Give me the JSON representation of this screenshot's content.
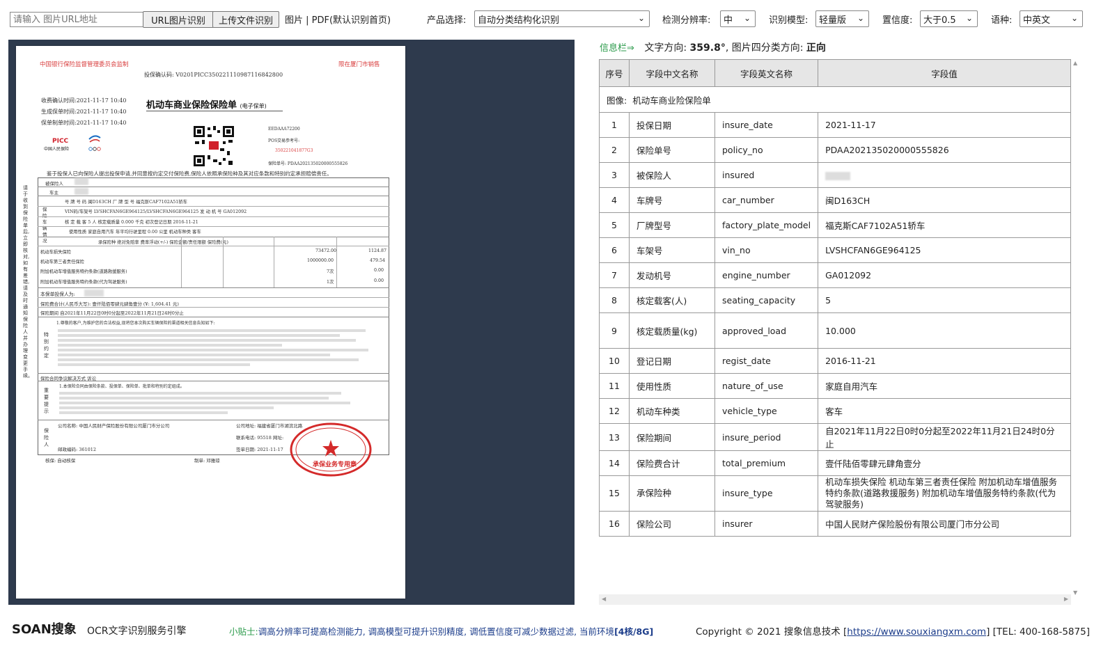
{
  "toolbar": {
    "url_placeholder": "请输入 图片URL地址",
    "url_button": "URL图片识别",
    "upload_button": "上传文件识别",
    "file_hint": "图片 | PDF(默认识别首页)",
    "product_label": "产品选择:",
    "product_value": "自动分类结构化识别",
    "resolution_label": "检测分辨率:",
    "resolution_value": "中",
    "model_label": "识别模型:",
    "model_value": "轻量版",
    "confidence_label": "置信度:",
    "confidence_value": "大于0.5",
    "language_label": "语种:",
    "language_value": "中英文"
  },
  "document": {
    "header_left": "中国银行保险监督管理委员会监制",
    "header_right": "限在厦门市销售",
    "confirm_code": "投保确认码: V0201PICC350221110987116842800",
    "receipt_time": "收费确认时间:2021-11-17 10:40",
    "gen_time": "生成保单时间:2021-11-17 10:40",
    "print_time": "保单制单时间:2021-11-17 10:40",
    "title": "机动车商业保险保险单",
    "title_suffix": "(电子保单)",
    "logo": "PICC",
    "logo_sub": "中国人民保险",
    "ref1": "EEDAAA72200",
    "ref2": "POS交易参考号:",
    "ref3": "350221041877G3",
    "policy_no_line": "保险单号: PDAA202135020000555826",
    "intro": "鉴于投保人已向保险人提出投保申请,并同意按约定交付保险费,保险人依照承保险种及其对应条款和特别约定承担赔偿责任。",
    "plate_row": "号 牌 号 码   闽D163CH      厂 牌 型 号   福克斯CAF7102A51轿车",
    "vin_row": "VIN码/车架号  LVSHCFAN6GE964125/LVSHCFAN6GE964125    发 动 机 号  GA012092",
    "cap_row": "核 定 载 客   5   人   核定载质量  0.000   千克   初次登记日期   2016-11-21",
    "use_row": "使用性质  家庭自用汽车   年平均行驶里程  0.00   公里   机动车种类   客车",
    "cov_header": "承保险种        绝对免赔率     费率浮动(+/-)     保险金额/责任限额     保险费(元)",
    "cov1": "机动车损失保险",
    "cov1_amt": "73472.00",
    "cov1_fee": "1124.87",
    "cov2": "机动车第三者责任保险",
    "cov2_amt": "1000000.00",
    "cov2_fee": "479.54",
    "cov3": "附加机动车增值服务特约条款(道路救援服务)",
    "cov3_amt": "7次",
    "cov3_fee": "0.00",
    "cov4": "附加机动车增值服务特约条款(代为驾驶服务)",
    "cov4_amt": "1次",
    "cov4_fee": "0.00",
    "applicant": "本保单投保人为:",
    "total": "保险费合计(人民币大写):       壹仟陆佰零肆元肆角壹分                (¥: 1,604.41         元)",
    "period": "保险期间  自2021年11月22日0时0分起至2022年11月21日24时0分止",
    "special_text": "1.尊敬的客户,为维护您的合法权益,现将您本次购买车辆保险的渠道相关信息告知如下:",
    "dispute": "保险合同争议解决方式   诉讼",
    "important_text": "1.本保险合同由保险条款、投保单、保险单、批单和特别约定组成。",
    "insurer_name": "公司名称: 中国人民财产保险股份有限公司厦门市分公司",
    "insurer_addr": "公司地址: 福建省厦门市湖滨北路",
    "insurer_phone": "联系电话: 95518  网址:",
    "postcode": "邮政编码: 361012",
    "sign_date": "签单日期: 2021-11-17",
    "underwrite": "核保: 自动核保",
    "maker": "制单: 邓雅琼",
    "stamp_text": "承保业务专用章",
    "side_note": "请于收到保险单后,立即核对,如有差错,请及时通知保险人并办理变更手续。"
  },
  "info": {
    "label": "信息栏⇒",
    "text_dir_label": "文字方向:",
    "text_dir_value": "359.8°",
    "img_dir_label": "图片四分类方向:",
    "img_dir_value": "正向"
  },
  "table": {
    "headers": [
      "序号",
      "字段中文名称",
      "字段英文名称",
      "字段值"
    ],
    "image_row_label": "图像:",
    "image_row_value": "机动车商业险保险单",
    "rows": [
      {
        "no": "1",
        "cn": "投保日期",
        "en": "insure_date",
        "val": "2021-11-17"
      },
      {
        "no": "2",
        "cn": "保险单号",
        "en": "policy_no",
        "val": "PDAA202135020000555826"
      },
      {
        "no": "3",
        "cn": "被保险人",
        "en": "insured",
        "val": ""
      },
      {
        "no": "4",
        "cn": "车牌号",
        "en": "car_number",
        "val": "闽D163CH"
      },
      {
        "no": "5",
        "cn": "厂牌型号",
        "en": "factory_plate_model",
        "val": "福克斯CAF7102A51轿车"
      },
      {
        "no": "6",
        "cn": "车架号",
        "en": "vin_no",
        "val": "LVSHCFAN6GE964125"
      },
      {
        "no": "7",
        "cn": "发动机号",
        "en": "engine_number",
        "val": "GA012092"
      },
      {
        "no": "8",
        "cn": "核定载客(人)",
        "en": "seating_capacity",
        "val": "5"
      },
      {
        "no": "9",
        "cn": "核定载质量(kg)",
        "en": "approved_load",
        "val": "10.000"
      },
      {
        "no": "10",
        "cn": "登记日期",
        "en": "regist_date",
        "val": "2016-11-21"
      },
      {
        "no": "11",
        "cn": "使用性质",
        "en": "nature_of_use",
        "val": "家庭自用汽车"
      },
      {
        "no": "12",
        "cn": "机动车种类",
        "en": "vehicle_type",
        "val": "客车"
      },
      {
        "no": "13",
        "cn": "保险期间",
        "en": "insure_period",
        "val": "自2021年11月22日0时0分起至2022年11月21日24时0分止"
      },
      {
        "no": "14",
        "cn": "保险费合计",
        "en": "total_premium",
        "val": "壹仟陆佰零肆元肆角壹分"
      },
      {
        "no": "15",
        "cn": "承保险种",
        "en": "insure_type",
        "val": "机动车损失保险 机动车第三者责任保险 附加机动车增值服务特约条款(道路救援服务) 附加机动车增值服务特约条款(代为驾驶服务)"
      },
      {
        "no": "16",
        "cn": "保险公司",
        "en": "insurer",
        "val": "中国人民财产保险股份有限公司厦门市分公司"
      }
    ]
  },
  "footer": {
    "logo": "SOAN搜象",
    "engine": "OCR文字识别服务引擎",
    "tip_label": "小贴士:",
    "tip": "调高分辨率可提高检测能力, 调高模型可提升识别精度, 调低置信度可减少数据过滤, 当前环境",
    "env": "[4核/8G]",
    "copyright": "Copyright © 2021 搜象信息技术 [",
    "link": "https://www.souxiangxm.com",
    "tel": "] [TEL: 400-168-5875]"
  }
}
